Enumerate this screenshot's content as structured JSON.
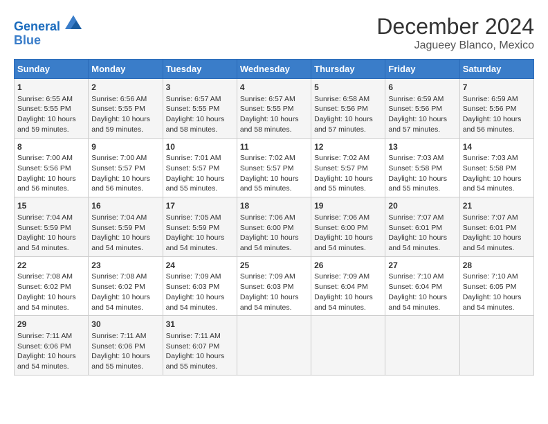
{
  "logo": {
    "line1": "General",
    "line2": "Blue"
  },
  "title": "December 2024",
  "subtitle": "Jagueey Blanco, Mexico",
  "days_of_week": [
    "Sunday",
    "Monday",
    "Tuesday",
    "Wednesday",
    "Thursday",
    "Friday",
    "Saturday"
  ],
  "weeks": [
    [
      {
        "day": "1",
        "sunrise": "6:55 AM",
        "sunset": "5:55 PM",
        "daylight": "10 hours and 59 minutes."
      },
      {
        "day": "2",
        "sunrise": "6:56 AM",
        "sunset": "5:55 PM",
        "daylight": "10 hours and 59 minutes."
      },
      {
        "day": "3",
        "sunrise": "6:57 AM",
        "sunset": "5:55 PM",
        "daylight": "10 hours and 58 minutes."
      },
      {
        "day": "4",
        "sunrise": "6:57 AM",
        "sunset": "5:55 PM",
        "daylight": "10 hours and 58 minutes."
      },
      {
        "day": "5",
        "sunrise": "6:58 AM",
        "sunset": "5:56 PM",
        "daylight": "10 hours and 57 minutes."
      },
      {
        "day": "6",
        "sunrise": "6:59 AM",
        "sunset": "5:56 PM",
        "daylight": "10 hours and 57 minutes."
      },
      {
        "day": "7",
        "sunrise": "6:59 AM",
        "sunset": "5:56 PM",
        "daylight": "10 hours and 56 minutes."
      }
    ],
    [
      {
        "day": "8",
        "sunrise": "7:00 AM",
        "sunset": "5:56 PM",
        "daylight": "10 hours and 56 minutes."
      },
      {
        "day": "9",
        "sunrise": "7:00 AM",
        "sunset": "5:57 PM",
        "daylight": "10 hours and 56 minutes."
      },
      {
        "day": "10",
        "sunrise": "7:01 AM",
        "sunset": "5:57 PM",
        "daylight": "10 hours and 55 minutes."
      },
      {
        "day": "11",
        "sunrise": "7:02 AM",
        "sunset": "5:57 PM",
        "daylight": "10 hours and 55 minutes."
      },
      {
        "day": "12",
        "sunrise": "7:02 AM",
        "sunset": "5:57 PM",
        "daylight": "10 hours and 55 minutes."
      },
      {
        "day": "13",
        "sunrise": "7:03 AM",
        "sunset": "5:58 PM",
        "daylight": "10 hours and 55 minutes."
      },
      {
        "day": "14",
        "sunrise": "7:03 AM",
        "sunset": "5:58 PM",
        "daylight": "10 hours and 54 minutes."
      }
    ],
    [
      {
        "day": "15",
        "sunrise": "7:04 AM",
        "sunset": "5:59 PM",
        "daylight": "10 hours and 54 minutes."
      },
      {
        "day": "16",
        "sunrise": "7:04 AM",
        "sunset": "5:59 PM",
        "daylight": "10 hours and 54 minutes."
      },
      {
        "day": "17",
        "sunrise": "7:05 AM",
        "sunset": "5:59 PM",
        "daylight": "10 hours and 54 minutes."
      },
      {
        "day": "18",
        "sunrise": "7:06 AM",
        "sunset": "6:00 PM",
        "daylight": "10 hours and 54 minutes."
      },
      {
        "day": "19",
        "sunrise": "7:06 AM",
        "sunset": "6:00 PM",
        "daylight": "10 hours and 54 minutes."
      },
      {
        "day": "20",
        "sunrise": "7:07 AM",
        "sunset": "6:01 PM",
        "daylight": "10 hours and 54 minutes."
      },
      {
        "day": "21",
        "sunrise": "7:07 AM",
        "sunset": "6:01 PM",
        "daylight": "10 hours and 54 minutes."
      }
    ],
    [
      {
        "day": "22",
        "sunrise": "7:08 AM",
        "sunset": "6:02 PM",
        "daylight": "10 hours and 54 minutes."
      },
      {
        "day": "23",
        "sunrise": "7:08 AM",
        "sunset": "6:02 PM",
        "daylight": "10 hours and 54 minutes."
      },
      {
        "day": "24",
        "sunrise": "7:09 AM",
        "sunset": "6:03 PM",
        "daylight": "10 hours and 54 minutes."
      },
      {
        "day": "25",
        "sunrise": "7:09 AM",
        "sunset": "6:03 PM",
        "daylight": "10 hours and 54 minutes."
      },
      {
        "day": "26",
        "sunrise": "7:09 AM",
        "sunset": "6:04 PM",
        "daylight": "10 hours and 54 minutes."
      },
      {
        "day": "27",
        "sunrise": "7:10 AM",
        "sunset": "6:04 PM",
        "daylight": "10 hours and 54 minutes."
      },
      {
        "day": "28",
        "sunrise": "7:10 AM",
        "sunset": "6:05 PM",
        "daylight": "10 hours and 54 minutes."
      }
    ],
    [
      {
        "day": "29",
        "sunrise": "7:11 AM",
        "sunset": "6:06 PM",
        "daylight": "10 hours and 54 minutes."
      },
      {
        "day": "30",
        "sunrise": "7:11 AM",
        "sunset": "6:06 PM",
        "daylight": "10 hours and 55 minutes."
      },
      {
        "day": "31",
        "sunrise": "7:11 AM",
        "sunset": "6:07 PM",
        "daylight": "10 hours and 55 minutes."
      },
      null,
      null,
      null,
      null
    ]
  ],
  "labels": {
    "sunrise": "Sunrise:",
    "sunset": "Sunset:",
    "daylight": "Daylight:"
  }
}
